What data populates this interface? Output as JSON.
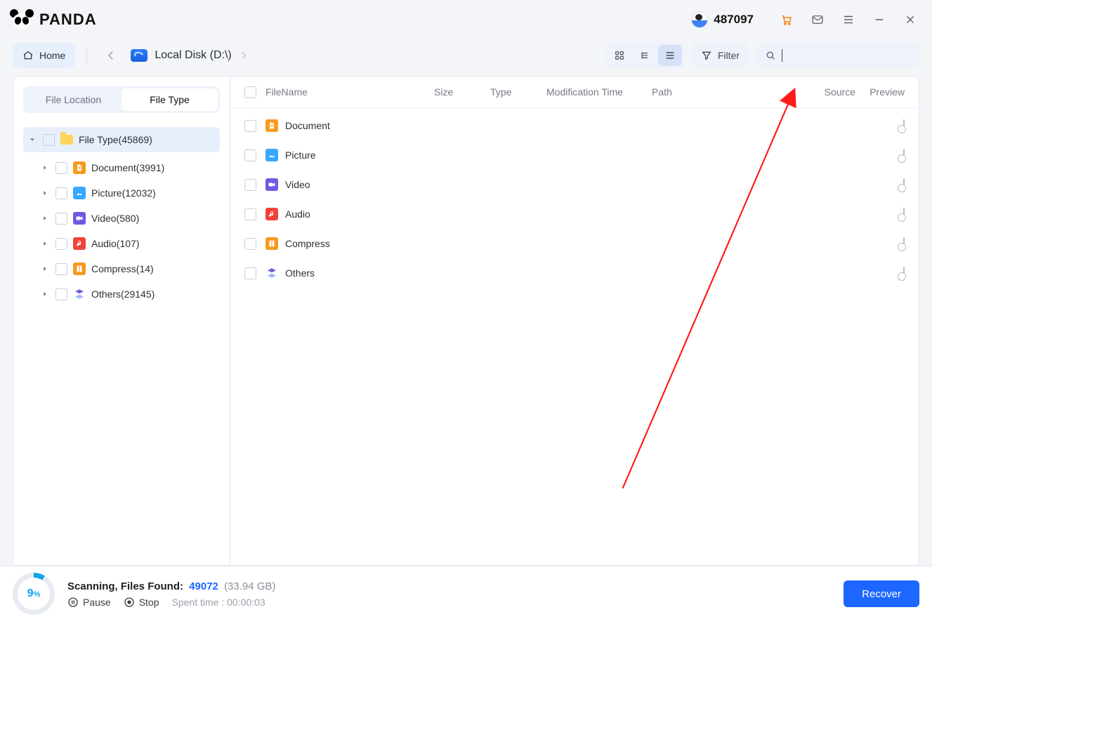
{
  "brand": {
    "name": "PANDA"
  },
  "titlebar": {
    "user_id": "487097"
  },
  "toolbar": {
    "home_label": "Home",
    "breadcrumb": "Local Disk (D:\\)",
    "filter_label": "Filter"
  },
  "sidebar": {
    "tabs": {
      "location": "File Location",
      "type": "File Type",
      "active": "type"
    },
    "root": {
      "label": "File Type(45869)"
    },
    "items": [
      {
        "key": "document",
        "label": "Document(3991)"
      },
      {
        "key": "picture",
        "label": "Picture(12032)"
      },
      {
        "key": "video",
        "label": "Video(580)"
      },
      {
        "key": "audio",
        "label": "Audio(107)"
      },
      {
        "key": "compress",
        "label": "Compress(14)"
      },
      {
        "key": "others",
        "label": "Others(29145)"
      }
    ]
  },
  "table": {
    "headers": {
      "name": "FileName",
      "size": "Size",
      "type": "Type",
      "mod": "Modification Time",
      "path": "Path",
      "source": "Source",
      "preview": "Preview"
    },
    "rows": [
      {
        "key": "document",
        "label": "Document"
      },
      {
        "key": "picture",
        "label": "Picture"
      },
      {
        "key": "video",
        "label": "Video"
      },
      {
        "key": "audio",
        "label": "Audio"
      },
      {
        "key": "compress",
        "label": "Compress"
      },
      {
        "key": "others",
        "label": "Others"
      }
    ]
  },
  "status": {
    "progress_label": "9",
    "progress_suffix": "%",
    "scanning_label": "Scanning, Files Found:",
    "found_count": "49072",
    "found_size": "(33.94 GB)",
    "pause": "Pause",
    "stop": "Stop",
    "spent": "Spent time : 00:00:03",
    "recover": "Recover"
  },
  "colors": {
    "accent": "#1d66ff",
    "progress": "#0ea5e9",
    "doc": "#f79a1f",
    "picture": "#38a7ff",
    "video": "#6d5ae3",
    "audio": "#f04438",
    "compress": "#f79a1f"
  }
}
